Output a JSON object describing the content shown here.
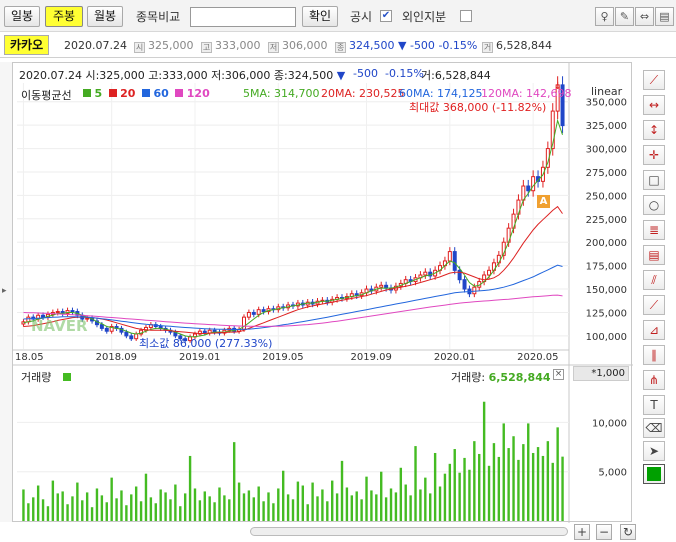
{
  "toolbar": {
    "daily": "일봉",
    "weekly": "주봉",
    "monthly": "월봉",
    "compare_label": "종목비교",
    "confirm": "확인",
    "disclosure": "공시",
    "foreign_label": "외인지분",
    "disclosure_checked": "✔"
  },
  "stock": {
    "name": "카카오",
    "date": "2020.07.24",
    "open": "325,000",
    "high": "333,000",
    "low": "306,000",
    "close": "324,500",
    "change_arrow": "▼",
    "change": "-500",
    "change_pct": "-0.15%",
    "volume": "6,528,844",
    "icon_open": "시",
    "icon_high": "고",
    "icon_low": "저",
    "icon_close": "종",
    "icon_volume": "거"
  },
  "header": {
    "date": "2020.07.24",
    "ohlc": "시:325,000 고:333,000 저:306,000 종:324,500",
    "arrow": "▼",
    "change": "-500",
    "change_pct": "-0.15%",
    "volume": "거:6,528,844",
    "ma_title": "이동평균선",
    "ma_legend": [
      "5",
      "20",
      "60",
      "120"
    ],
    "ma5": "5MA: 314,700",
    "ma20": "20MA: 230,525",
    "ma60": "60MA: 174,125",
    "ma120": "120MA: 142,698",
    "scale": "linear",
    "max_label": "최대값 368,000 (-11.82%)",
    "min_label": "최소값 86,000 (277.33%)",
    "watermark": "NAVER",
    "badge_a": "A"
  },
  "volume_panel": {
    "title": "거래량",
    "value_label": "거래량:",
    "value": "6,528,844",
    "unit": "*1,000",
    "close_x": "×"
  },
  "colors": {
    "up": "#e02020",
    "down": "#2046c8",
    "ma5": "#44aa22",
    "ma20": "#dd2222",
    "ma60": "#2266dd",
    "ma120": "#e048c0",
    "volume": "#44bb22",
    "highlight": "#ffff33"
  },
  "sidebar_icons": [
    "line-tool",
    "horizontal-line",
    "vertical-line",
    "cross-line",
    "rectangle",
    "circle",
    "fibonacci",
    "fibonacci-fan",
    "parallel-channel",
    "trend-line",
    "speed-line",
    "gann-line",
    "andrews-pitchfork",
    "text-tool",
    "eraser",
    "pointer",
    "color-picker"
  ],
  "chart_data": {
    "type": "candlestick",
    "x_ticks": [
      "18.05",
      "2018.09",
      "2019.01",
      "2019.05",
      "2019.09",
      "2020.01",
      "2020.05"
    ],
    "y_ticks": [
      "100,000",
      "125,000",
      "150,000",
      "175,000",
      "200,000",
      "225,000",
      "250,000",
      "275,000",
      "300,000",
      "325,000",
      "350,000"
    ],
    "ylim": [
      86000,
      370000
    ],
    "volume_ticks": [
      "5,000",
      "10,000"
    ],
    "volume_ylim": [
      0,
      14000
    ],
    "series": [
      {
        "name": "5",
        "type": "candles",
        "values": [
          115000,
          120000,
          118000,
          122000,
          120000,
          123000,
          125000,
          126000,
          124000,
          127000,
          126000,
          122000,
          118000,
          119000,
          116000,
          112000,
          108000,
          105000,
          110000,
          108000,
          104000,
          100000,
          97000,
          102000,
          106000,
          109000,
          112000,
          110000,
          108000,
          106000,
          104000,
          100000,
          97000,
          95000,
          99000,
          102000,
          105000,
          103000,
          106000,
          104000,
          103000,
          106000,
          108000,
          105000,
          107000,
          120000,
          125000,
          123000,
          128000,
          126000,
          129000,
          128000,
          131000,
          130000,
          133000,
          132000,
          135000,
          133000,
          136000,
          134000,
          137000,
          138000,
          136000,
          139000,
          141000,
          140000,
          142000,
          145000,
          143000,
          146000,
          150000,
          148000,
          152000,
          154000,
          151000,
          149000,
          153000,
          156000,
          160000,
          158000,
          162000,
          165000,
          168000,
          164000,
          170000,
          175000,
          180000,
          190000,
          170000,
          160000,
          150000,
          145000,
          152000,
          158000,
          165000,
          170000,
          178000,
          186000,
          200000,
          215000,
          230000,
          245000,
          260000,
          255000,
          270000,
          265000,
          280000,
          300000,
          340000,
          368000,
          324500
        ]
      },
      {
        "name": "5MA",
        "values": [
          114000,
          115000,
          116000,
          118000,
          119000,
          121000,
          122000,
          124000,
          124000,
          125000,
          125000,
          124000,
          122000,
          120000,
          118000,
          115000,
          113000,
          110000,
          109000,
          108000,
          107000,
          105000,
          103000,
          102000,
          103000,
          105000,
          107000,
          108000,
          108000,
          107000,
          106000,
          104000,
          102000,
          100000,
          99000,
          99000,
          100000,
          101000,
          103000,
          104000,
          104000,
          104000,
          105000,
          106000,
          107000,
          110000,
          114000,
          118000,
          122000,
          125000,
          127000,
          128000,
          129000,
          130000,
          131000,
          132000,
          133000,
          134000,
          135000,
          135000,
          136000,
          137000,
          137000,
          138000,
          139000,
          140000,
          141000,
          142000,
          143000,
          144000,
          146000,
          148000,
          150000,
          151000,
          151000,
          151000,
          152000,
          154000,
          156000,
          158000,
          160000,
          162000,
          164000,
          165000,
          167000,
          170000,
          175000,
          180000,
          178000,
          172000,
          165000,
          157000,
          153000,
          154000,
          158000,
          163000,
          170000,
          178000,
          188000,
          200000,
          215000,
          230000,
          245000,
          252000,
          260000,
          266000,
          272000,
          285000,
          305000,
          330000,
          314700
        ]
      },
      {
        "name": "20MA",
        "values": [
          110000,
          110500,
          111000,
          112000,
          113000,
          114000,
          115000,
          116500,
          117500,
          118500,
          119500,
          120000,
          120000,
          120000,
          119500,
          119000,
          118000,
          117000,
          115500,
          114000,
          112500,
          111000,
          109500,
          108000,
          107000,
          106500,
          106000,
          106000,
          106000,
          106000,
          105500,
          105000,
          104500,
          104000,
          103500,
          103000,
          102500,
          102500,
          103000,
          103000,
          103500,
          103500,
          104000,
          104000,
          104500,
          106000,
          108000,
          110000,
          112000,
          114000,
          116000,
          118000,
          120000,
          122000,
          124000,
          126000,
          128000,
          129500,
          131000,
          132000,
          133000,
          134000,
          135000,
          136000,
          137000,
          138000,
          139000,
          140000,
          141000,
          142000,
          143000,
          144500,
          146000,
          147500,
          149000,
          150000,
          151000,
          152000,
          153000,
          154000,
          155500,
          157000,
          158500,
          160000,
          161500,
          163000,
          165000,
          167000,
          168000,
          168000,
          167000,
          165000,
          163000,
          161000,
          160000,
          160500,
          162000,
          165000,
          170000,
          176000,
          183000,
          191000,
          199000,
          206000,
          213000,
          219000,
          224000,
          229000,
          234000,
          238000,
          230525
        ]
      },
      {
        "name": "60MA",
        "values": [
          118000,
          118300,
          118600,
          118900,
          119200,
          119500,
          119800,
          120100,
          120400,
          120500,
          120500,
          120400,
          120200,
          119900,
          119500,
          119000,
          118400,
          117800,
          117100,
          116400,
          115700,
          115000,
          114300,
          113600,
          113000,
          112400,
          111900,
          111400,
          111000,
          110600,
          110200,
          109800,
          109400,
          109000,
          108600,
          108300,
          108000,
          107700,
          107500,
          107300,
          107100,
          107000,
          106900,
          106800,
          106800,
          107000,
          107300,
          107700,
          108200,
          108800,
          109500,
          110200,
          111000,
          111800,
          112600,
          113500,
          114400,
          115300,
          116200,
          117100,
          118000,
          119000,
          120000,
          121000,
          122000,
          123000,
          124000,
          125000,
          126000,
          127000,
          128000,
          129000,
          130000,
          131000,
          132000,
          133000,
          134000,
          135000,
          136000,
          137000,
          138000,
          139000,
          140000,
          141000,
          142000,
          143000,
          144000,
          145000,
          146000,
          146500,
          147000,
          147300,
          147600,
          148000,
          148500,
          149000,
          149800,
          150800,
          152000,
          153500,
          155000,
          157000,
          159000,
          161000,
          163000,
          165500,
          168000,
          170500,
          173000,
          175500,
          174125
        ]
      },
      {
        "name": "120MA",
        "values": [
          125000,
          124800,
          124600,
          124400,
          124200,
          124000,
          123800,
          123500,
          123200,
          122900,
          122600,
          122300,
          122000,
          121600,
          121200,
          120800,
          120400,
          120000,
          119600,
          119200,
          118800,
          118400,
          118000,
          117600,
          117200,
          116800,
          116400,
          116000,
          115600,
          115200,
          114800,
          114400,
          114000,
          113600,
          113300,
          113000,
          112700,
          112400,
          112100,
          111800,
          111500,
          111200,
          111000,
          110800,
          110600,
          110400,
          110300,
          110200,
          110100,
          110100,
          110100,
          110200,
          110300,
          110500,
          110700,
          111000,
          111300,
          111700,
          112100,
          112600,
          113100,
          113700,
          114300,
          115000,
          115700,
          116400,
          117200,
          118000,
          118800,
          119600,
          120400,
          121200,
          122000,
          122800,
          123600,
          124400,
          125200,
          126000,
          126800,
          127600,
          128400,
          129200,
          130000,
          130800,
          131500,
          132200,
          132900,
          133600,
          134300,
          135000,
          135500,
          136000,
          136400,
          136800,
          137200,
          137600,
          138000,
          138400,
          138800,
          139200,
          139700,
          140200,
          140700,
          141200,
          141700,
          142100,
          142500,
          142900,
          143300,
          143600,
          142698
        ]
      },
      {
        "name": "거래량",
        "values": [
          3200,
          1800,
          2400,
          3600,
          2200,
          1500,
          4100,
          2800,
          3000,
          1700,
          2500,
          3900,
          2100,
          2900,
          1400,
          3300,
          2600,
          1900,
          4400,
          2300,
          3100,
          1600,
          2700,
          3500,
          2000,
          4800,
          2400,
          1800,
          3200,
          2900,
          2200,
          3700,
          1500,
          2800,
          6600,
          3300,
          2100,
          3000,
          2500,
          1900,
          3400,
          2600,
          2200,
          8000,
          3900,
          2800,
          3100,
          2400,
          3500,
          2000,
          2900,
          1800,
          3300,
          5100,
          2700,
          2200,
          4000,
          3600,
          1700,
          3900,
          2500,
          3200,
          2000,
          4100,
          2800,
          6100,
          3400,
          2600,
          3000,
          2200,
          4500,
          3100,
          2700,
          5000,
          2400,
          3300,
          2900,
          5400,
          3700,
          2600,
          7600,
          3200,
          4400,
          2800,
          6900,
          3500,
          4800,
          5800,
          7300,
          4900,
          6400,
          5200,
          8100,
          6800,
          12100,
          5600,
          7900,
          6500,
          9900,
          7400,
          8600,
          6200,
          7800,
          9900,
          6900,
          7500,
          6600,
          8100,
          5900,
          9500,
          6529
        ]
      }
    ],
    "annotations": [
      "최대값 368,000 (-11.82%)",
      "최소값 86,000 (277.33%)"
    ]
  }
}
